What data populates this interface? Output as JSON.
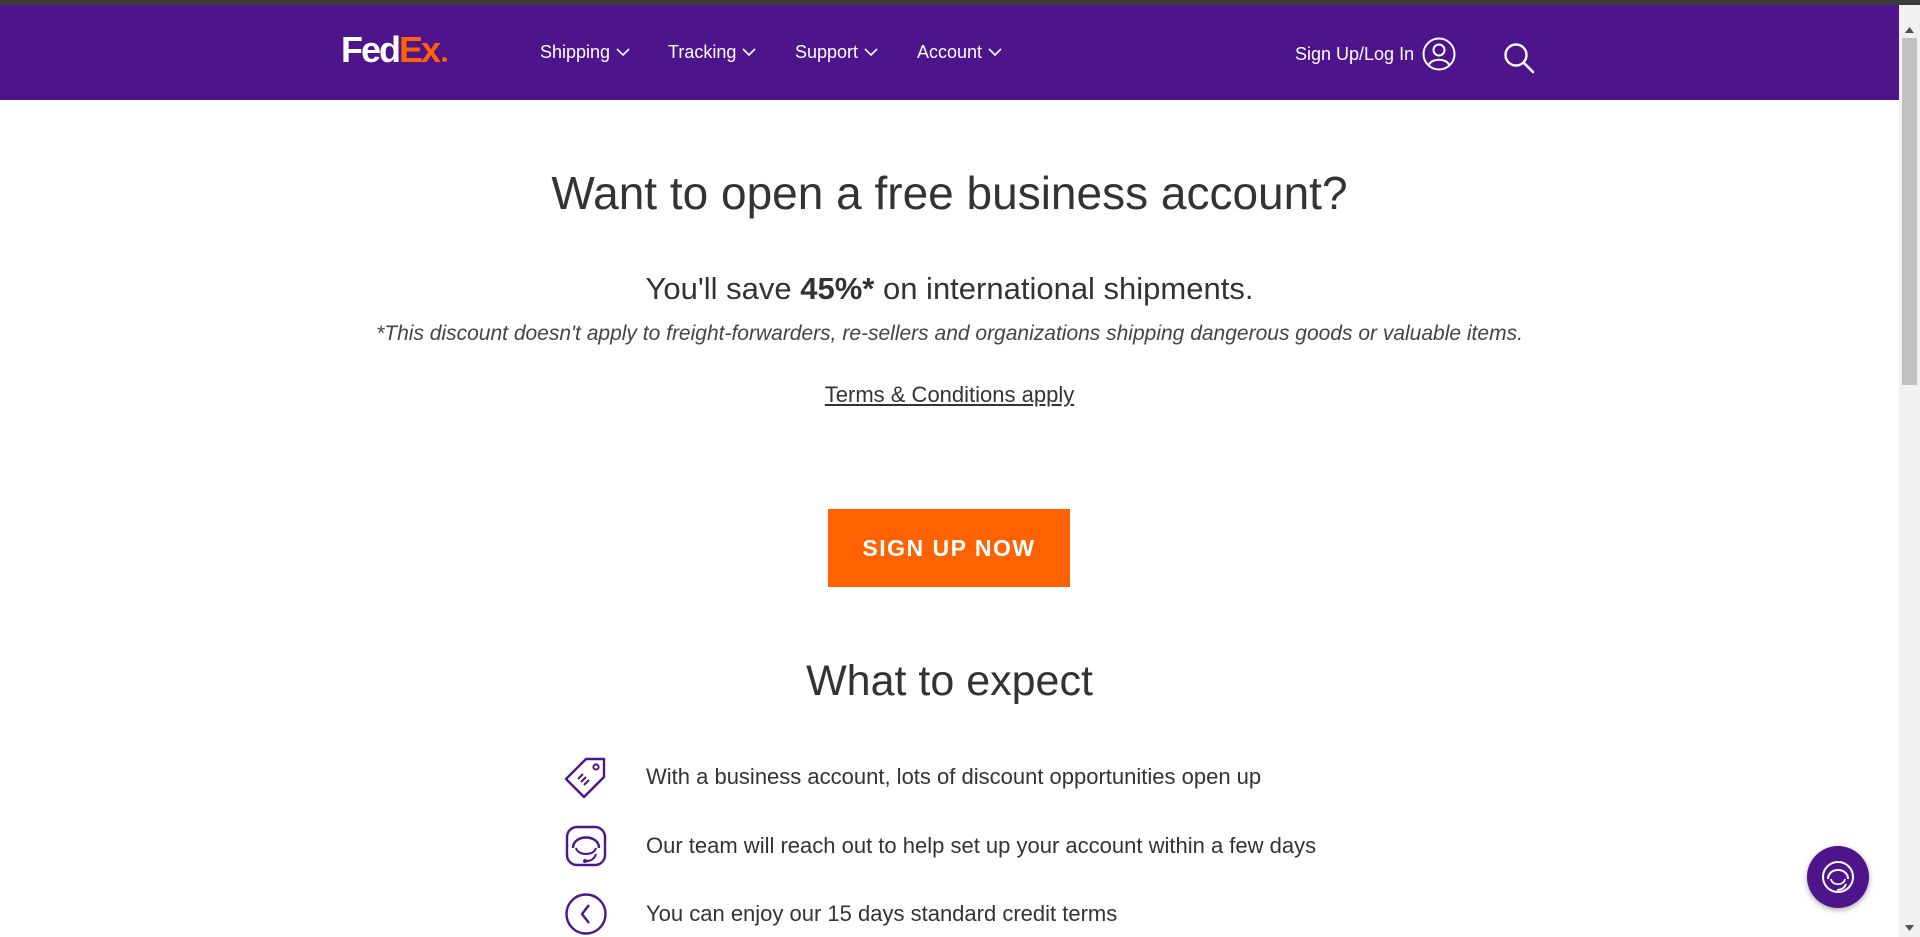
{
  "brand": {
    "logo_part1": "Fed",
    "logo_part2": "Ex",
    "purple": "#4d148c",
    "orange": "#ff6200"
  },
  "nav": {
    "items": [
      {
        "label": "Shipping",
        "icon": "chevron-down-icon"
      },
      {
        "label": "Tracking",
        "icon": "chevron-down-icon"
      },
      {
        "label": "Support",
        "icon": "chevron-down-icon"
      },
      {
        "label": "Account",
        "icon": "chevron-down-icon"
      }
    ],
    "signin_label": "Sign Up/Log In",
    "signin_icon": "user-icon",
    "search_icon": "search-icon"
  },
  "hero": {
    "title": "Want to open a free business account?",
    "save_prefix": "You'll save ",
    "save_value": "45%*",
    "save_suffix": " on international shipments.",
    "disclaimer": "*This discount doesn't apply to freight-forwarders, re-sellers and organizations shipping dangerous goods or valuable items.",
    "terms_link": "Terms & Conditions apply",
    "cta_label": "SIGN UP NOW"
  },
  "expect": {
    "title": "What to expect",
    "items": [
      {
        "icon": "price-tag-icon",
        "text": "With a business account, lots of discount opportunities open up"
      },
      {
        "icon": "support-agent-icon",
        "text": "Our team will reach out to help set up your account within a few days"
      },
      {
        "icon": "clock-icon",
        "text": "You can enjoy our 15 days standard credit terms"
      }
    ]
  },
  "chat": {
    "icon": "chat-agent-icon"
  }
}
